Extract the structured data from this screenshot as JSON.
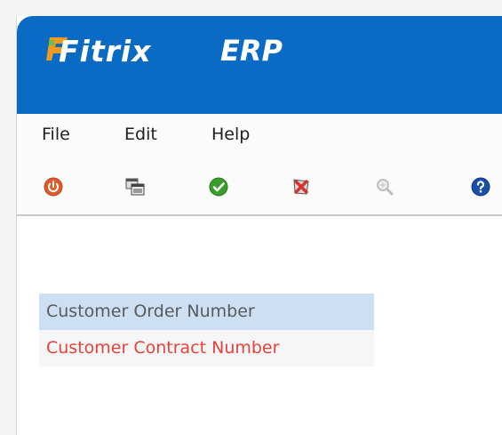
{
  "app": {
    "logo_text": "Fitrix",
    "logo_suffix": "ERP"
  },
  "menu": {
    "items": [
      {
        "label": "File"
      },
      {
        "label": "Edit"
      },
      {
        "label": "Help"
      }
    ]
  },
  "toolbar": {
    "buttons": [
      {
        "icon": "power-icon",
        "enabled": true
      },
      {
        "icon": "windows-icon",
        "enabled": true
      },
      {
        "icon": "checkmark-icon",
        "enabled": true
      },
      {
        "icon": "cancel-icon",
        "enabled": true
      },
      {
        "icon": "zoom-icon",
        "enabled": false
      },
      {
        "icon": "help-icon",
        "enabled": true
      }
    ]
  },
  "list": {
    "items": [
      {
        "label": "Customer Order Number",
        "state": "selected"
      },
      {
        "label": "Customer Contract Number",
        "state": "required"
      }
    ]
  },
  "colors": {
    "header": "#0a6bc4",
    "selected_row": "#cde0f3",
    "required_text": "#e8413a"
  }
}
